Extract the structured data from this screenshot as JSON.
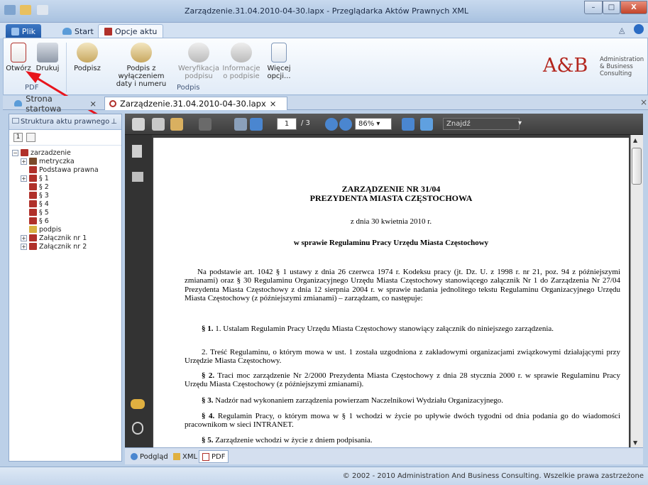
{
  "window": {
    "title": "Zarządzenie.31.04.2010-04-30.lapx - Przeglądarka Aktów Prawnych XML",
    "min": "–",
    "max": "□",
    "close": "X"
  },
  "ribbon_tabs": {
    "plik": "Plik",
    "start": "Start",
    "opcje": "Opcje aktu"
  },
  "ribbon": {
    "otworz": "Otwórz",
    "drukuj": "Drukuj",
    "podpisz": "Podpisz",
    "podpis_wyl": [
      "Podpis z wyłączeniem",
      "daty i numeru"
    ],
    "weryfikacja": [
      "Weryfikacja",
      "podpisu"
    ],
    "informacje": [
      "Informacje",
      "o podpisie"
    ],
    "wiecej": [
      "Więcej",
      "opcji..."
    ],
    "group_pdf": "PDF",
    "group_podpis": "Podpis"
  },
  "logo": {
    "mark": "A&B",
    "line1": "Administration",
    "line2": "& Business",
    "line3": "Consulting"
  },
  "doc_tabs": {
    "tab1": "Strona startowa",
    "tab2": "Zarządzenie.31.04.2010-04-30.lapx",
    "close": "×"
  },
  "left_panel": {
    "title": "Struktura aktu prawnego",
    "pin": "⊥",
    "tree": [
      {
        "label": "zarzadzenie",
        "exp": "−",
        "indent": 0,
        "color": "#b0302a"
      },
      {
        "label": "metryczka",
        "exp": "+",
        "indent": 1,
        "color": "#7a4a2a"
      },
      {
        "label": "Podstawa prawna",
        "exp": "",
        "indent": 1,
        "color": "#b0302a"
      },
      {
        "label": "§ 1",
        "exp": "+",
        "indent": 1,
        "color": "#b0302a"
      },
      {
        "label": "§ 2",
        "exp": "",
        "indent": 1,
        "color": "#b0302a"
      },
      {
        "label": "§ 3",
        "exp": "",
        "indent": 1,
        "color": "#b0302a"
      },
      {
        "label": "§ 4",
        "exp": "",
        "indent": 1,
        "color": "#b0302a"
      },
      {
        "label": "§ 5",
        "exp": "",
        "indent": 1,
        "color": "#b0302a"
      },
      {
        "label": "§ 6",
        "exp": "",
        "indent": 1,
        "color": "#b0302a"
      },
      {
        "label": "podpis",
        "exp": "",
        "indent": 1,
        "color": "#d8b040"
      },
      {
        "label": "Załącznik nr 1",
        "exp": "+",
        "indent": 1,
        "color": "#b0302a"
      },
      {
        "label": "Załącznik nr 2",
        "exp": "+",
        "indent": 1,
        "color": "#b0302a"
      }
    ]
  },
  "viewer": {
    "page": "1",
    "total": "/ 3",
    "zoom": "86%",
    "search_placeholder": "Znajdź",
    "tabs": {
      "podglad": "Podgląd",
      "xml": "XML",
      "pdf": "PDF"
    }
  },
  "document": {
    "title1": "ZARZĄDZENIE NR 31/04",
    "title2": "PREZYDENTA MIASTA CZĘSTOCHOWA",
    "date": "z dnia 30 kwietnia 2010 r.",
    "subject": "w sprawie Regulaminu Pracy Urzędu Miasta Częstochowy",
    "para1": "Na podstawie art. 1042 § 1 ustawy z dnia 26 czerwca 1974 r. Kodeksu pracy (jt. Dz. U. z 1998 r. nr 21, poz. 94 z późniejszymi zmianami) oraz § 30 Regulaminu Organizacyjnego Urzędu Miasta Częstochowy stanowiącego załącznik Nr 1 do Zarządzenia Nr 27/04 Prezydenta Miasta Częstochowy z dnia 12 sierpnia 2004 r. w sprawie nadania jednolitego tekstu Regulaminu Organizacyjnego Urzędu Miasta Częstochowy (z późniejszymi zmianami) – zarządzam, co następuje:",
    "p1_label": "§ 1.",
    "p1_text": " 1. Ustalam Regulamin Pracy Urzędu Miasta Częstochowy stanowiący załącznik do niniejszego zarządzenia.",
    "p1b": "2. Treść Regulaminu, o którym mowa w ust. 1 została uzgodniona z zakładowymi organizacjami związkowymi działającymi przy Urzędzie Miasta Częstochowy.",
    "p2_label": "§ 2.",
    "p2_text": " Traci moc zarządzenie Nr 2/2000 Prezydenta Miasta Częstochowy z dnia 28 stycznia 2000 r. w sprawie Regulaminu Pracy Urzędu Miasta Częstochowy (z późniejszymi zmianami).",
    "p3_label": "§ 3.",
    "p3_text": " Nadzór nad wykonaniem zarządzenia powierzam Naczelnikowi Wydziału Organizacyjnego.",
    "p4_label": "§ 4.",
    "p4_text": " Regulamin Pracy, o którym mowa w § 1 wchodzi w życie po upływie dwóch tygodni od dnia podania go do wiadomości pracownikom w sieci INTRANET.",
    "p5_label": "§ 5.",
    "p5_text": " Zarządzenie wchodzi w życie z dniem podpisania."
  },
  "status": "© 2002 - 2010 Administration And Business Consulting. Wszelkie prawa zastrzeżone"
}
